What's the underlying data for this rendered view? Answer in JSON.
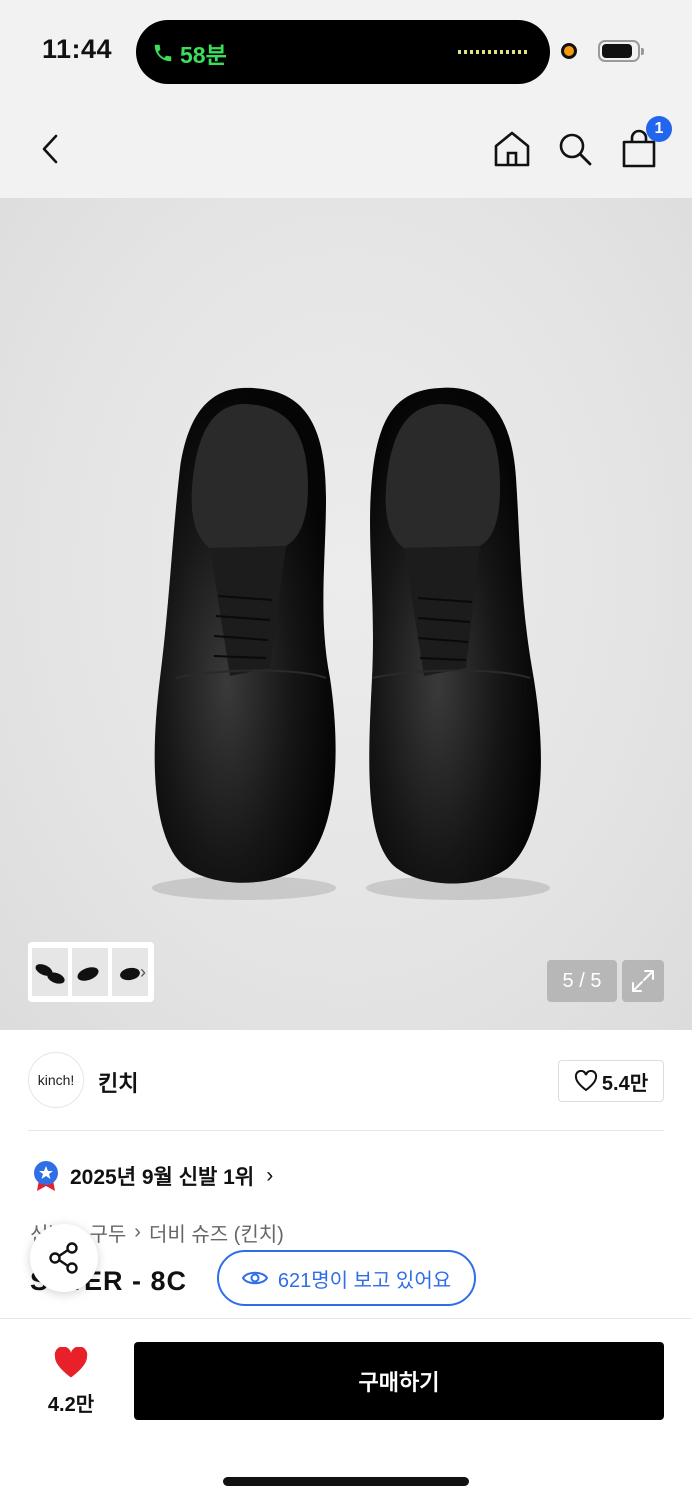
{
  "status_bar": {
    "time": "11:44",
    "call_duration": "58분"
  },
  "nav": {
    "cart_count": "1",
    "icons": [
      "back-icon",
      "home-icon",
      "search-icon",
      "cart-icon"
    ]
  },
  "gallery": {
    "counter": "5 / 5",
    "expand_icon": "expand-icon",
    "thumbnail_more_icon": "chevron-right-icon"
  },
  "brand": {
    "logo_text": "kinch!",
    "name": "킨치",
    "likes": "5.4만"
  },
  "ranking": {
    "text": "2025년 9월 신발 1위",
    "icon": "star-badge-icon"
  },
  "breadcrumb": {
    "items": [
      "신발",
      "구두",
      "더비 슈즈 (킨치)"
    ]
  },
  "product": {
    "name_visible": "S  WER - 8C"
  },
  "viewers": {
    "text": "621명이 보고 있어요",
    "icon": "eye-icon"
  },
  "bottom_bar": {
    "wish_count": "4.2만",
    "buy_label": "구매하기"
  },
  "colors": {
    "accent_blue": "#2f6ee6",
    "badge_blue": "#2266ee",
    "heart_red": "#e8202a",
    "call_green": "#3ddc5a"
  }
}
